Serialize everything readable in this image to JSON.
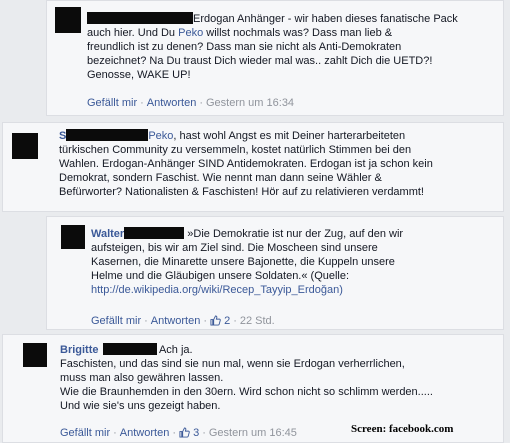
{
  "c1": {
    "lines": [
      "Erdogan Anhänger - wir haben dieses fanatische Pack",
      "auch hier. Und Du ",
      "freundlich ist zu denen? Dass man sie nicht als Anti-Demokraten",
      "bezeichnet? Na Du traust Dich wieder mal was.. zahlt Dich die UETD?!",
      "Genosse, WAKE UP!"
    ],
    "mention": "Peko",
    "line2_tail": " willst nochmals was? Dass man lieb &",
    "like": "Gefällt mir",
    "reply": "Antworten",
    "time": "Gestern um 16:34"
  },
  "c2": {
    "name_prefix": "S",
    "mention": "Peko",
    "line1_tail": ", hast wohl Angst es mit Deiner harterarbeiteten",
    "lines": [
      "türkischen Community zu versemmeln, kostet natürlich Stimmen bei den",
      "Wahlen. Erdogan-Anhänger SIND Antidemokraten. Erdogan ist ja schon kein",
      "Demokrat, sondern Faschist. Wie nennt man dann seine Wähler &",
      "Befürworter? Nationalisten & Faschisten! Hör auf zu relativieren verdammt!"
    ]
  },
  "c3": {
    "name": "Walter",
    "line1_tail": " »Die Demokratie ist nur der Zug, auf den wir",
    "lines": [
      "aufsteigen, bis wir am Ziel sind. Die Moscheen sind unsere",
      "Kasernen, die Minarette unsere Bajonette, die Kuppeln unsere",
      "Helme und die Gläubigen unsere Soldaten.« (Quelle:"
    ],
    "url": "http://de.wikipedia.org/wiki/Recep_Tayyip_Erdoğan)",
    "like": "Gefällt mir",
    "reply": "Antworten",
    "likes": "2",
    "time": "22 Std."
  },
  "c4": {
    "name": "Brigitte",
    "line1_tail": " Ach ja.",
    "lines": [
      "Faschisten, und das sind sie nun mal, wenn sie Erdogan verherrlichen,",
      "muss man also gewähren lassen.",
      "Wie die Braunhemden in den 30ern. Wird schon nicht so schlimm werden.....",
      "Und wie sie's uns gezeigt haben."
    ],
    "like": "Gefällt mir",
    "reply": "Antworten",
    "likes": "3",
    "time": "Gestern um 16:45"
  },
  "credit": "Screen: facebook.com"
}
